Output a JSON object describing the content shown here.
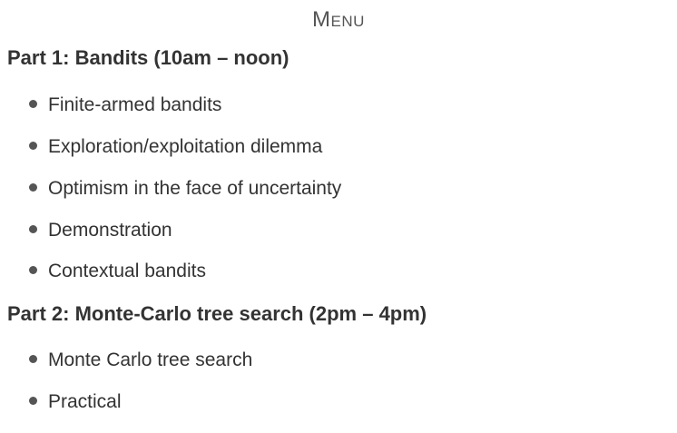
{
  "menu_title": "Menu",
  "part1": {
    "heading": "Part 1: Bandits (10am – noon)",
    "items": [
      "Finite-armed bandits",
      "Exploration/exploitation dilemma",
      "Optimism in the face of uncertainty",
      "Demonstration",
      "Contextual bandits"
    ]
  },
  "part2": {
    "heading": "Part 2: Monte-Carlo tree search (2pm – 4pm)",
    "items": [
      "Monte Carlo tree search",
      "Practical"
    ]
  }
}
